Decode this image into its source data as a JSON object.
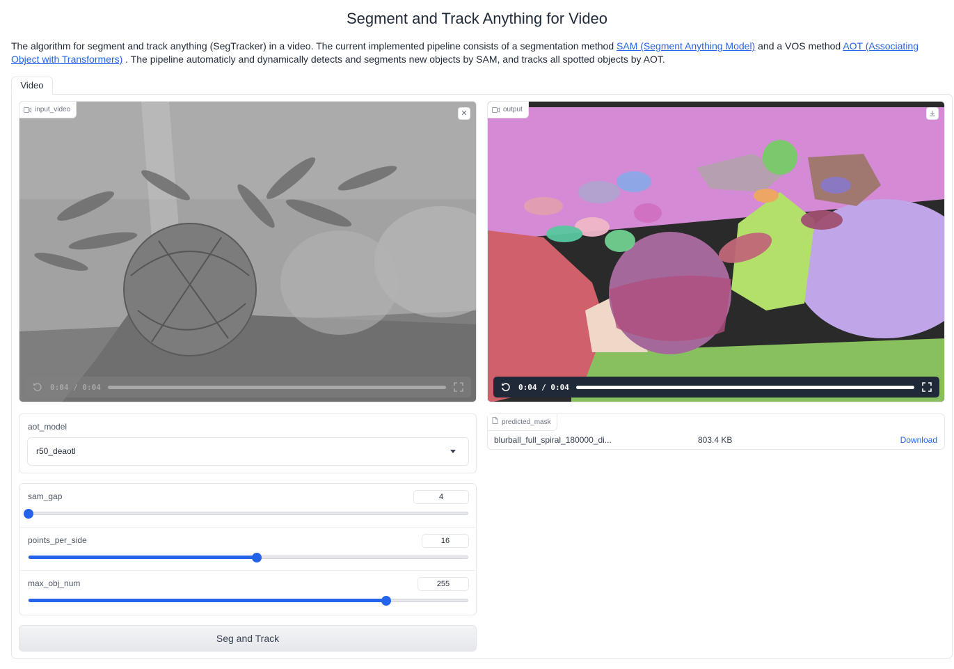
{
  "header": {
    "title": "Segment and Track Anything for Video",
    "desc_prefix": "The algorithm for segment and track anything (SegTracker) in a video. The current implemented pipeline consists of a segmentation method ",
    "sam_link": "SAM (Segment Anything Model)",
    "desc_mid": " and a VOS method ",
    "aot_link": "AOT (Associating Object with Transformers)",
    "desc_suffix": " . The pipeline automaticly and dynamically detects and segments new objects by SAM, and tracks all spotted objects by AOT."
  },
  "tabs": [
    {
      "label": "Video"
    }
  ],
  "input_video": {
    "label": "input_video",
    "icon": "video-camera-icon",
    "close_icon": "close-icon",
    "time": "0:04 / 0:04",
    "progress": 1.0
  },
  "output_video": {
    "label": "output",
    "icon": "video-camera-icon",
    "download_icon": "download-icon",
    "time": "0:04 / 0:04",
    "progress": 1.0
  },
  "aot_model": {
    "label": "aot_model",
    "selected": "r50_deaotl"
  },
  "sliders": [
    {
      "id": "sam-gap",
      "label": "sam_gap",
      "value": "4",
      "fraction": 0.0
    },
    {
      "id": "points-per-side",
      "label": "points_per_side",
      "value": "16",
      "fraction": 0.52
    },
    {
      "id": "max-obj-num",
      "label": "max_obj_num",
      "value": "255",
      "fraction": 0.815
    }
  ],
  "run_button": {
    "label": "Seg and Track"
  },
  "predicted_mask": {
    "label": "predicted_mask",
    "file_name": "blurball_full_spiral_180000_di...",
    "file_size": "803.4 KB",
    "download_label": "Download"
  },
  "colors": {
    "accent": "#2563eb",
    "segment_pink": "#d48ad4",
    "segment_red": "#d0606a",
    "segment_purple": "#a4689a",
    "segment_green": "#88c060",
    "segment_lavender": "#c0a6e8"
  }
}
